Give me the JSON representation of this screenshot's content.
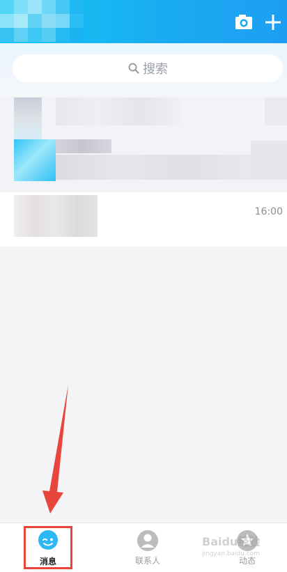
{
  "search": {
    "label": "搜索"
  },
  "conversations": [
    {
      "time": ""
    },
    {
      "time": ""
    },
    {
      "time": "16:00"
    }
  ],
  "tabs": [
    {
      "label": "消息",
      "selected": true
    },
    {
      "label": "联系人",
      "selected": false
    },
    {
      "label": "动态",
      "selected": false
    }
  ],
  "watermark": {
    "text": "Baidu经验",
    "subtext": "jingyan.baidu.com"
  },
  "colors": {
    "header": "#1aaaf2",
    "highlight": "#e8453c"
  }
}
